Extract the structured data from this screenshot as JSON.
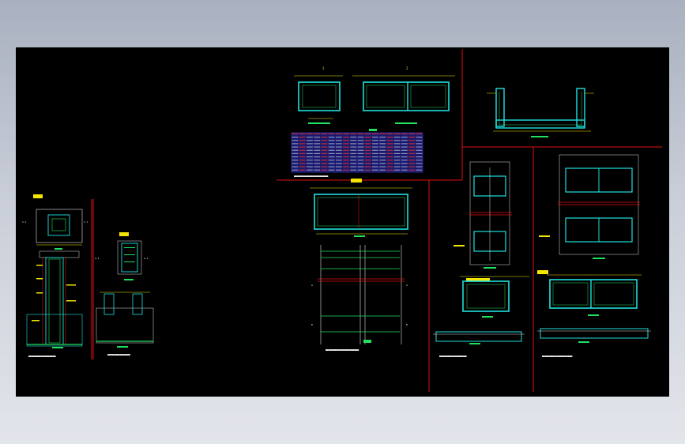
{
  "colors": {
    "background": "#000000",
    "frame": "#e01010",
    "outline": "#20e0e0",
    "rebar": "#20e060",
    "dimension": "#f4e600",
    "text": "#f2f2f2",
    "table": "#3030c0",
    "table_highlight": "#e03020"
  },
  "labels": {
    "sec_1": "1-1",
    "sec_2": "2-2",
    "sec_a": "A",
    "sec_b": "B"
  },
  "table": {
    "rows": 12,
    "cols": 18
  }
}
